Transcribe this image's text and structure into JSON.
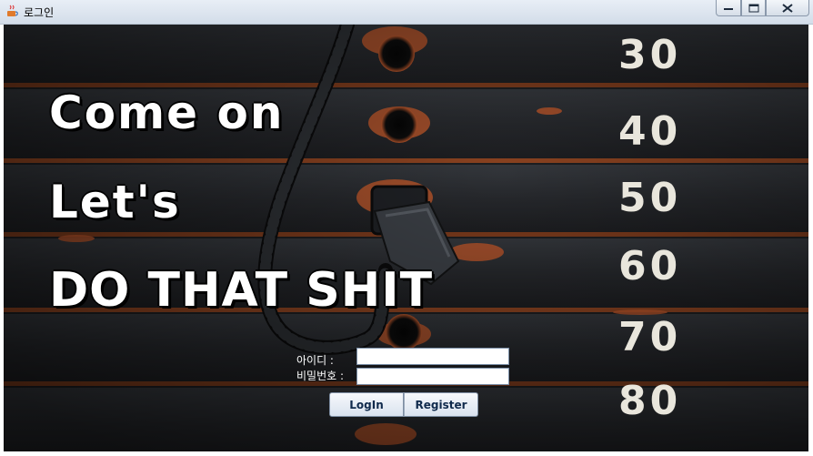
{
  "window": {
    "title": "로그인",
    "icon": "java-cup-icon",
    "controls": {
      "minimize": "minimize-icon",
      "maximize": "maximize-icon",
      "close": "close-icon"
    }
  },
  "hero": {
    "line1": "Come on",
    "line2": "Let's",
    "line3": "DO THAT SHIT"
  },
  "weight_stack": [
    "30",
    "40",
    "50",
    "60",
    "70",
    "80"
  ],
  "login_form": {
    "id_label": "아이디 :",
    "password_label": "비밀번호 :",
    "id_value": "",
    "password_value": "",
    "login_button": "LogIn",
    "register_button": "Register"
  },
  "colors": {
    "rust": "#b5542a",
    "plate": "#2a2c30",
    "button_text": "#102a4c"
  }
}
